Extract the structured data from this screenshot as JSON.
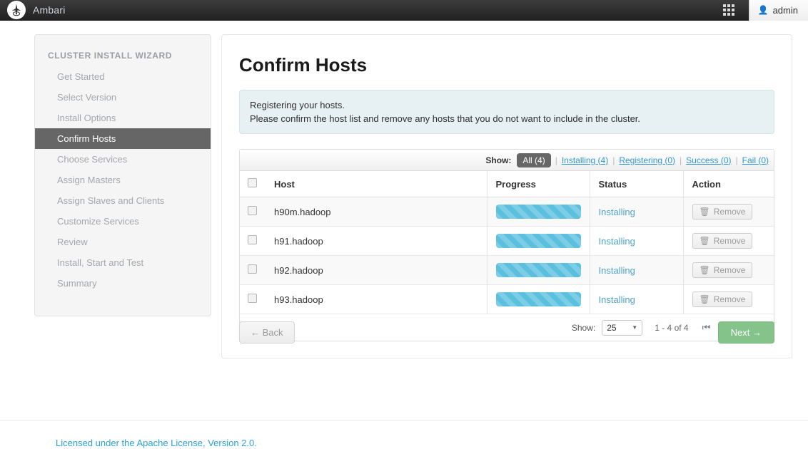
{
  "topnav": {
    "brand": "Ambari",
    "logo_icon": "ambari-logo-icon",
    "apps_grid_icon": "grid-apps-icon",
    "user_icon": "user-icon",
    "admin_label": "admin"
  },
  "sidebar": {
    "title": "CLUSTER INSTALL WIZARD",
    "items": [
      {
        "label": "Get Started",
        "active": false
      },
      {
        "label": "Select Version",
        "active": false
      },
      {
        "label": "Install Options",
        "active": false
      },
      {
        "label": "Confirm Hosts",
        "active": true
      },
      {
        "label": "Choose Services",
        "active": false
      },
      {
        "label": "Assign Masters",
        "active": false
      },
      {
        "label": "Assign Slaves and Clients",
        "active": false
      },
      {
        "label": "Customize Services",
        "active": false
      },
      {
        "label": "Review",
        "active": false
      },
      {
        "label": "Install, Start and Test",
        "active": false
      },
      {
        "label": "Summary",
        "active": false
      }
    ]
  },
  "main": {
    "page_title": "Confirm Hosts",
    "info": {
      "line1": "Registering your hosts.",
      "line2": "Please confirm the host list and remove any hosts that you do not want to include in the cluster."
    },
    "filter": {
      "show_label": "Show:",
      "active_chip": "All (4)",
      "links": [
        "Installing (4)",
        "Registering (0)",
        "Success (0)",
        "Fail (0)"
      ],
      "separator": "|"
    },
    "table": {
      "headers": {
        "host": "Host",
        "progress": "Progress",
        "status": "Status",
        "action": "Action"
      },
      "rows": [
        {
          "host": "h90m.hadoop",
          "progress": 100,
          "status": "Installing",
          "action": "Remove"
        },
        {
          "host": "h91.hadoop",
          "progress": 100,
          "status": "Installing",
          "action": "Remove"
        },
        {
          "host": "h92.hadoop",
          "progress": 100,
          "status": "Installing",
          "action": "Remove"
        },
        {
          "host": "h93.hadoop",
          "progress": 100,
          "status": "Installing",
          "action": "Remove"
        }
      ]
    },
    "pager": {
      "show_label": "Show:",
      "page_size": "25",
      "range": "1 - 4 of 4",
      "first_icon": "⏮",
      "prev_icon": "←",
      "next_icon": "→",
      "last_icon": "⏭"
    },
    "buttons": {
      "back": "← Back",
      "next": "Next →"
    }
  },
  "footer": {
    "license": "Licensed under the Apache License, Version 2.0."
  },
  "colors": {
    "accent_blue": "#3399cc",
    "status_blue": "#4ea3cc",
    "progress_blue": "#5bc0de",
    "next_green": "#84c38a",
    "active_nav": "#666666",
    "info_bg": "#e7f0f3"
  }
}
